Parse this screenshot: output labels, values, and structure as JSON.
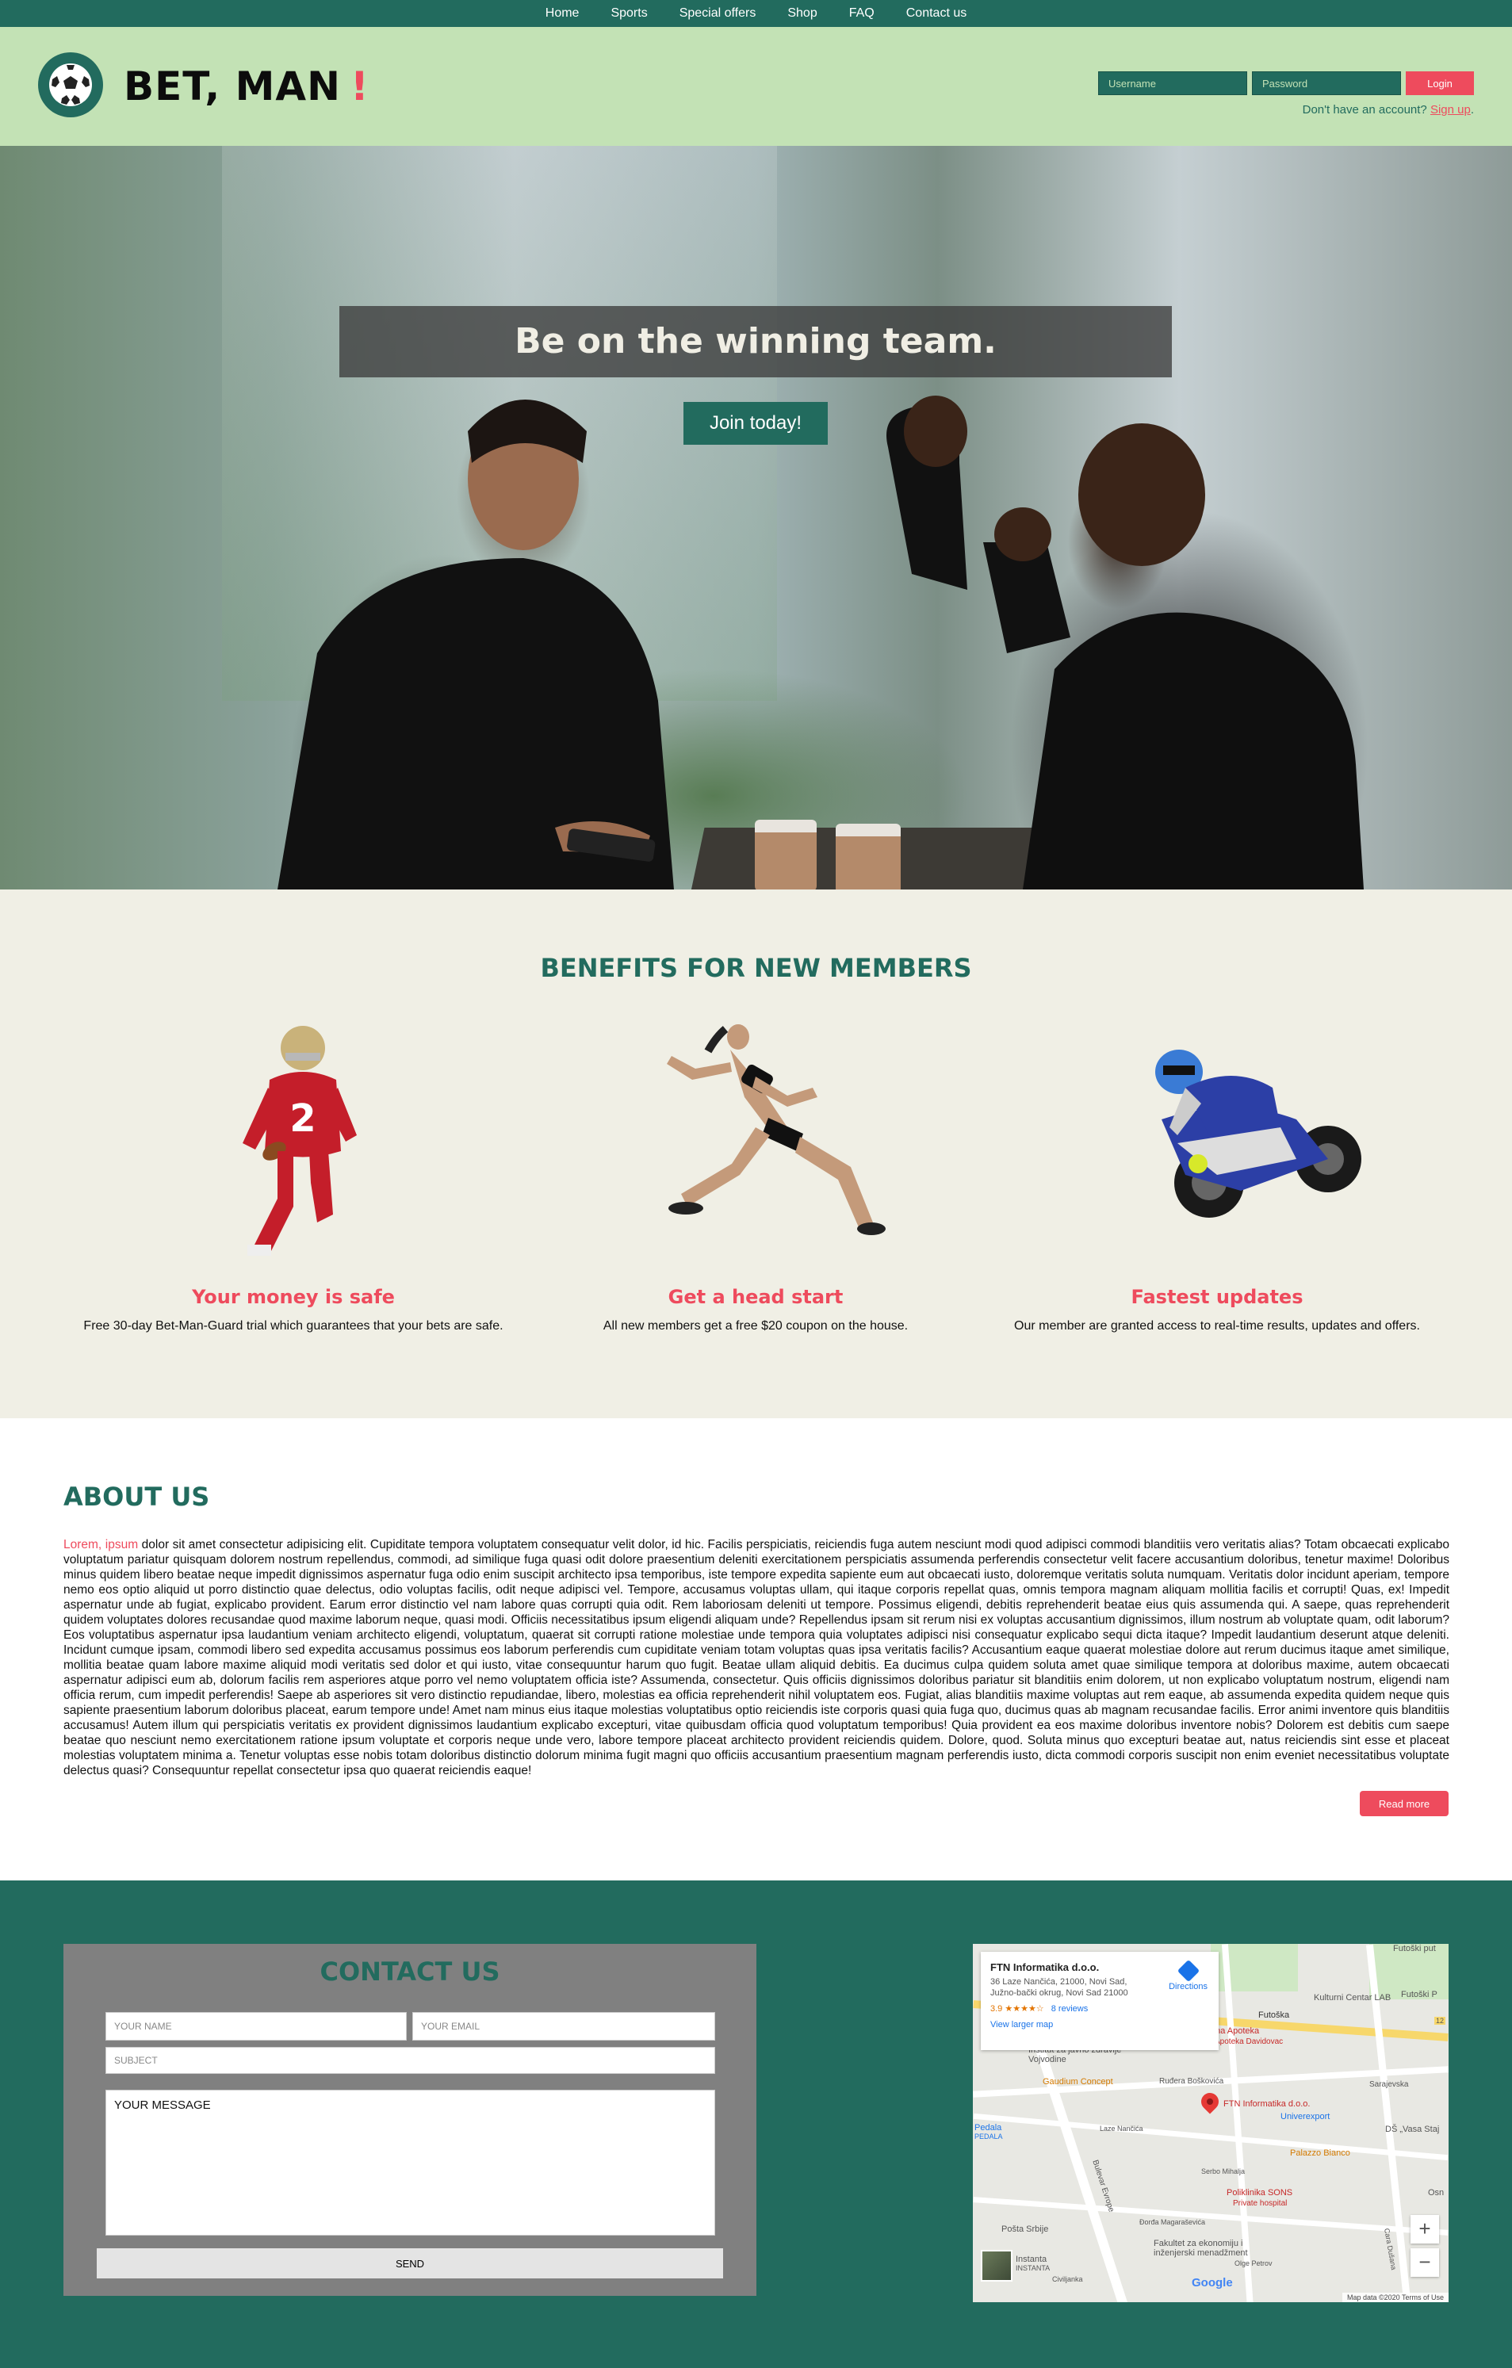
{
  "nav": {
    "items": [
      {
        "label": "Home"
      },
      {
        "label": "Sports"
      },
      {
        "label": "Special offers"
      },
      {
        "label": "Shop"
      },
      {
        "label": "FAQ"
      },
      {
        "label": "Contact us"
      }
    ]
  },
  "header": {
    "brand": "BET, MAN",
    "brand_bang": "!",
    "logo_icon": "soccer-ball-icon",
    "username_placeholder": "Username",
    "password_placeholder": "Password",
    "login_label": "Login",
    "signup_prompt": "Don't have an account?",
    "signup_link": "Sign up",
    "signup_suffix": "."
  },
  "hero": {
    "title": "Be on the winning team.",
    "cta": "Join today!"
  },
  "benefits": {
    "title": "BENEFITS FOR NEW MEMBERS",
    "items": [
      {
        "title": "Your money is safe",
        "text": "Free 30-day Bet-Man-Guard trial which guarantees that your bets are safe.",
        "image": "football-player"
      },
      {
        "title": "Get a head start",
        "text": "All new members get a free $20 coupon on the house.",
        "image": "running-woman"
      },
      {
        "title": "Fastest updates",
        "text": "Our member are granted access to real-time results, updates and offers.",
        "image": "motorcycle-racer"
      }
    ]
  },
  "about": {
    "title": "ABOUT US",
    "lead": "Lorem, ipsum",
    "body": " dolor sit amet consectetur adipisicing elit. Cupiditate tempora voluptatem consequatur velit dolor, id hic. Facilis perspiciatis, reiciendis fuga autem nesciunt modi quod adipisci commodi blanditiis vero veritatis alias? Totam obcaecati explicabo voluptatum pariatur quisquam dolorem nostrum repellendus, commodi, ad similique fuga quasi odit dolore praesentium deleniti exercitationem perspiciatis assumenda perferendis consectetur velit facere accusantium doloribus, tenetur maxime! Doloribus minus quidem libero beatae neque impedit dignissimos aspernatur fuga odio enim suscipit architecto ipsa temporibus, iste tempore expedita sapiente eum aut obcaecati iusto, doloremque veritatis soluta numquam. Veritatis dolor incidunt aperiam, tempore nemo eos optio aliquid ut porro distinctio quae delectus, odio voluptas facilis, odit neque adipisci vel. Tempore, accusamus voluptas ullam, qui itaque corporis repellat quas, omnis tempora magnam aliquam mollitia facilis et corrupti! Quas, ex! Impedit aspernatur unde ab fugiat, explicabo provident. Earum error distinctio vel nam labore quas corrupti quia odit. Rem laboriosam deleniti ut tempore. Possimus eligendi, debitis reprehenderit beatae eius quis assumenda qui. A saepe, quas reprehenderit quidem voluptates dolores recusandae quod maxime laborum neque, quasi modi. Officiis necessitatibus ipsum eligendi aliquam unde? Repellendus ipsam sit rerum nisi ex voluptas accusantium dignissimos, illum nostrum ab voluptate quam, odit laborum? Eos voluptatibus aspernatur ipsa laudantium veniam architecto eligendi, voluptatum, quaerat sit corrupti ratione molestiae unde tempora quia voluptates adipisci nisi consequatur explicabo sequi dicta itaque? Impedit laudantium deserunt atque deleniti. Incidunt cumque ipsam, commodi libero sed expedita accusamus possimus eos laborum perferendis cum cupiditate veniam totam voluptas quas ipsa veritatis facilis? Accusantium eaque quaerat molestiae dolore aut rerum ducimus itaque amet similique, mollitia beatae quam labore maxime aliquid modi veritatis sed dolor et qui iusto, vitae consequuntur harum quo fugit. Beatae ullam aliquid debitis. Ea ducimus culpa quidem soluta amet quae similique tempora at doloribus maxime, autem obcaecati aspernatur adipisci eum ab, dolorum facilis rem asperiores atque porro vel nemo voluptatem officia iste? Assumenda, consectetur. Quis officiis dignissimos doloribus pariatur sit blanditiis enim dolorem, ut non explicabo voluptatum nostrum, eligendi nam officia rerum, cum impedit perferendis! Saepe ab asperiores sit vero distinctio repudiandae, libero, molestias ea officia reprehenderit nihil voluptatem eos. Fugiat, alias blanditiis maxime voluptas aut rem eaque, ab assumenda expedita quidem neque quis sapiente praesentium laborum doloribus placeat, earum tempore unde! Amet nam minus eius itaque molestias voluptatibus optio reiciendis iste corporis quasi quia fuga quo, ducimus quas ab magnam recusandae facilis. Error animi inventore quis blanditiis accusamus! Autem illum qui perspiciatis veritatis ex provident dignissimos laudantium explicabo excepturi, vitae quibusdam officia quod voluptatum temporibus! Quia provident ea eos maxime doloribus inventore nobis? Dolorem est debitis cum saepe beatae quo nesciunt nemo exercitationem ratione ipsum voluptate et corporis neque unde vero, labore tempore placeat architecto provident reiciendis quidem. Dolore, quod. Soluta minus quo excepturi beatae aut, natus reiciendis sint esse et placeat molestias voluptatem minima a. Tenetur voluptas esse nobis totam doloribus distinctio dolorum minima fugit magni quo officiis accusantium praesentium magnam perferendis iusto, dicta commodi corporis suscipit non enim eveniet necessitatibus voluptate delectus quasi? Consequuntur repellat consectetur ipsa quo quaerat reiciendis eaque!",
    "read_more": "Read more"
  },
  "contact": {
    "title": "CONTACT US",
    "name_placeholder": "YOUR NAME",
    "email_placeholder": "YOUR EMAIL",
    "subject_placeholder": "SUBJECT",
    "message_placeholder": "YOUR MESSAGE",
    "send_label": "SEND"
  },
  "map": {
    "place_name": "FTN Informatika d.o.o.",
    "address": "36 Laze Nančića, 21000, Novi Sad, Južno-bački okrug, Novi Sad 21000",
    "rating": "3.9",
    "stars": "★★★★☆",
    "reviews": "8 reviews",
    "directions": "Directions",
    "larger_map": "View larger map",
    "labels": {
      "futoski_top": "Futoški put",
      "kulturni": "Kulturni Centar LAB",
      "futoski_park": "Futoški P",
      "futoska": "Futoška",
      "apoteka": "ena Apoteka",
      "apoteka2": "Apoteka Davidovac",
      "institut": "Institut za javno zdravlje Vojvodine",
      "gaudium": "Gaudium Concept",
      "rudjera": "Ruđera Boškovića",
      "sarajevska": "Sarajevska",
      "ftn_pin": "FTN Informatika d.o.o.",
      "univerexport": "Univerexport",
      "ds": "DŠ „Vasa Staj",
      "pedala": "Pedala",
      "pedala2": "PEDALA",
      "laze": "Laze Nančića",
      "bulevar": "Bulevar Evrope",
      "palazzo": "Palazzo Bianco",
      "serbo": "Serbo Mihalja",
      "poliklinika": "Poliklinika SONS",
      "poliklinika2": "Private hospital",
      "posta": "Pošta Srbije",
      "djordja": "Đorđa Magaraševića",
      "fakultet": "Fakultet za ekonomiju i inženjerski menadžment",
      "olge": "Olge Petrov",
      "instanta": "Instanta",
      "instanta2": "INSTANTA",
      "civiljanka": "Civiljanka",
      "osn": "Osn",
      "cara": "Cara Dušana",
      "google": "Google",
      "terms": "Map data ©2020   Terms of Use",
      "badge": "12"
    }
  },
  "colors": {
    "primary": "#226b5e",
    "accent": "#ee4b5d",
    "header_bg": "#c3e2b5",
    "benefits_bg": "#f0efe5"
  }
}
